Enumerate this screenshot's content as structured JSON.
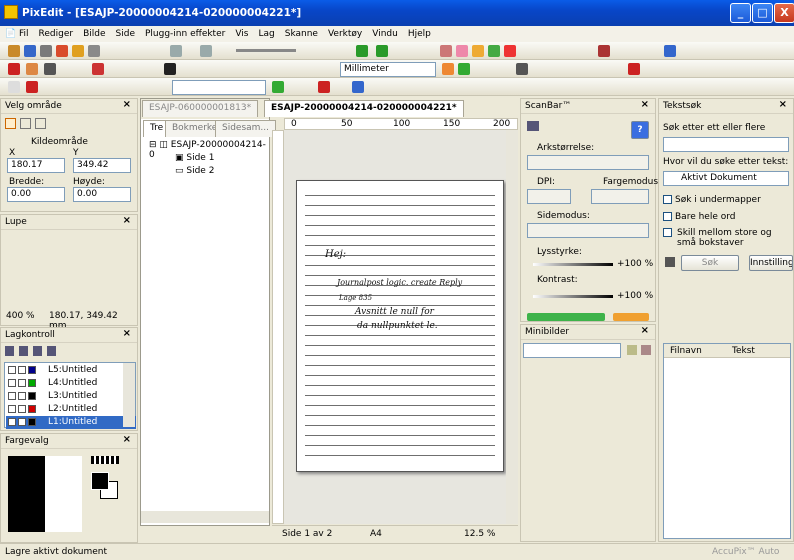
{
  "window": {
    "title": "PixEdit - [ESAJP-20000004214-020000004221*]",
    "minimize": "_",
    "maximize": "□",
    "close": "X"
  },
  "menu": [
    "Fil",
    "Rediger",
    "Bilde",
    "Side",
    "Plugg-inn effekter",
    "Vis",
    "Lag",
    "Skanne",
    "Verktøy",
    "Vindu",
    "Hjelp"
  ],
  "toolbar": {
    "units": "Millimeter"
  },
  "select_area": {
    "title": "Velg område",
    "group": "Kildeområde",
    "x_label": "X",
    "y_label": "Y",
    "x": "180.17",
    "y": "349.42",
    "w_label": "Bredde:",
    "h_label": "Høyde:",
    "w": "0.00",
    "h": "0.00"
  },
  "loupe": {
    "title": "Lupe",
    "zoom": "400 %",
    "coords": "180.17, 349.42 mm"
  },
  "layers": {
    "title": "Lagkontroll",
    "items": [
      {
        "label": "L5:Untitled",
        "color": "#00008b"
      },
      {
        "label": "L4:Untitled",
        "color": "#00aa00"
      },
      {
        "label": "L3:Untitled",
        "color": "#000000"
      },
      {
        "label": "L2:Untitled",
        "color": "#d00000"
      },
      {
        "label": "L1:Untitled",
        "color": "#000000"
      }
    ]
  },
  "color": {
    "title": "Fargevalg"
  },
  "tree": {
    "tabs": [
      "Tre",
      "Bokmerker",
      "Sidesam..."
    ],
    "root": "ESAJP-20000004214-0",
    "pages": [
      "Side 1",
      "Side 2"
    ]
  },
  "doc_tabs": [
    "ESAJP-060000001813*",
    "ESAJP-20000004214-020000004221*"
  ],
  "ruler": {
    "ticks": [
      "0",
      "50",
      "100",
      "150",
      "200"
    ]
  },
  "handwriting": [
    "Hej:",
    "Journalpost logic. create Reply",
    "Lage 835",
    "Avsnitt le null for",
    "da nullpunktet le."
  ],
  "doc_status": {
    "page": "Side 1 av 2",
    "size": "A4",
    "zoom": "12.5 %"
  },
  "scanbar": {
    "title": "ScanBar™",
    "help": "?",
    "paper_label": "Arkstørrelse:",
    "dpi_label": "DPI:",
    "color_label": "Fargemodus:",
    "side_label": "Sidemodus:",
    "brightness_label": "Lysstyrke:",
    "brightness": "+100 %",
    "contrast_label": "Kontrast:",
    "contrast": "+100 %"
  },
  "thumbs": {
    "title": "Minibilder"
  },
  "search": {
    "title": "Tekstsøk",
    "find_label": "Søk etter ett eller flere",
    "where_label": "Hvor vil du søke etter tekst:",
    "where_value": "Aktivt Dokument",
    "opt1": "Søk i undermapper",
    "opt2": "Bare hele ord",
    "opt3": "Skill mellom store og små bokstaver",
    "search_btn": "Søk",
    "settings_btn": "Innstilling",
    "col_file": "Filnavn",
    "col_text": "Tekst"
  },
  "status": {
    "left": "Lagre aktivt dokument",
    "right": "AccuPix™ Auto"
  }
}
